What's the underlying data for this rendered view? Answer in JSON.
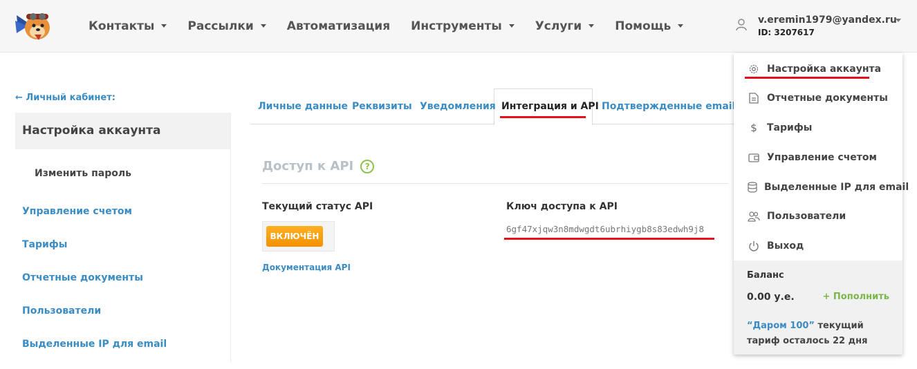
{
  "header": {
    "nav": [
      {
        "label": "Контакты"
      },
      {
        "label": "Рассылки"
      },
      {
        "label": "Автоматизация"
      },
      {
        "label": "Инструменты"
      },
      {
        "label": "Услуги"
      },
      {
        "label": "Помощь"
      }
    ],
    "user": {
      "email": "v.eremin1979@yandex.ru",
      "id": "ID: 3207617"
    }
  },
  "sidebar": {
    "back_label": "← Личный кабинет:",
    "active": "Настройка аккаунта",
    "sub": "Изменить пароль",
    "links": [
      "Управление счетом",
      "Тарифы",
      "Отчетные документы",
      "Пользователи",
      "Выделенные IP для email"
    ]
  },
  "tabs": [
    "Личные данные",
    "Реквизиты",
    "Уведомления",
    "Интеграция и API",
    "Подтвержденные email"
  ],
  "api": {
    "title": "Доступ к API",
    "help": "?",
    "status_label": "Текущий статус API",
    "status_button": "ВКЛЮЧЁН",
    "doc_link": "Документация API",
    "key_label": "Ключ доступа к API",
    "key_value": "6gf47xjqw3n8mdwgdt6ubrhiygb8s83edwh9j8"
  },
  "dropdown": {
    "items": [
      {
        "label": "Настройка аккаунта",
        "icon": "gear-icon"
      },
      {
        "label": "Отчетные документы",
        "icon": "document-icon"
      },
      {
        "label": "Тарифы",
        "icon": "dollar-icon"
      },
      {
        "label": "Управление счетом",
        "icon": "wallet-icon"
      },
      {
        "label": "Выделенные IP для email",
        "icon": "database-icon"
      },
      {
        "label": "Пользователи",
        "icon": "users-icon"
      },
      {
        "label": "Выход",
        "icon": "power-icon"
      }
    ],
    "balance_label": "Баланс",
    "balance_value": "0.00 у.е.",
    "topup": "+ Пополнить",
    "tariff_name": "“Даром 100”",
    "tariff_text": " текущий тариф осталось 22 дня"
  },
  "colors": {
    "accent_red": "#e5101a",
    "link_blue": "#3a8cc4",
    "orange": "#f39200",
    "green": "#7ab648"
  }
}
